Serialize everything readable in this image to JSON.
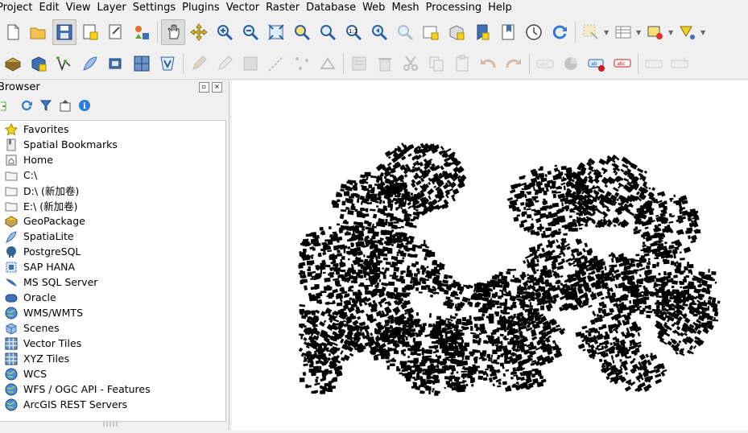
{
  "menubar": {
    "items": [
      "Project",
      "Edit",
      "View",
      "Layer",
      "Settings",
      "Plugins",
      "Vector",
      "Raster",
      "Database",
      "Web",
      "Mesh",
      "Processing",
      "Help"
    ]
  },
  "toolbar1": {
    "icons": [
      "new-project-icon",
      "open-project-icon",
      "save-project-icon",
      "new-print-layout-icon",
      "layout-manager-icon",
      "style-manager-icon",
      "pan-icon",
      "pan-to-selection-icon",
      "zoom-in-icon",
      "zoom-out-icon",
      "zoom-full-icon",
      "zoom-to-selection-icon",
      "zoom-to-layer-icon",
      "zoom-native-icon",
      "zoom-last-icon",
      "zoom-next-icon",
      "new-map-view-icon",
      "new-3d-map-view-icon",
      "new-bookmark-icon",
      "show-bookmarks-icon",
      "temporal-controller-icon",
      "refresh-icon",
      "select-features-icon",
      "attribute-table-icon",
      "deselect-icon",
      "add-shape-icon"
    ]
  },
  "toolbar2": {
    "icons": [
      "add-geopackage-layer-icon",
      "add-postgis-layer-icon",
      "add-vector-layer-icon",
      "add-spatialite-layer-icon",
      "add-sap-hana-layer-icon",
      "add-raster-layer-icon",
      "add-wms-layer-icon",
      "current-edits-icon",
      "toggle-editing-icon",
      "save-edits-icon",
      "digitize-icon",
      "vertex-tool-icon",
      "add-part-icon",
      "attribute-form-icon",
      "delete-selected-icon",
      "cut-features-icon",
      "copy-features-icon",
      "paste-features-icon",
      "undo-icon",
      "redo-icon",
      "label-icon",
      "diagram-icon",
      "highlight-label-icon",
      "pin-label-icon",
      "show-hide-labels-icon",
      "move-label-icon"
    ]
  },
  "browser": {
    "title": "Browser",
    "items": [
      {
        "label": "Favorites",
        "icon": "star-icon"
      },
      {
        "label": "Spatial Bookmarks",
        "icon": "bookmark-icon"
      },
      {
        "label": "Home",
        "icon": "home-folder-icon"
      },
      {
        "label": "C:\\",
        "icon": "folder-icon"
      },
      {
        "label": "D:\\ (新加卷)",
        "icon": "folder-icon"
      },
      {
        "label": "E:\\ (新加卷)",
        "icon": "folder-icon"
      },
      {
        "label": "GeoPackage",
        "icon": "geopackage-icon"
      },
      {
        "label": "SpatiaLite",
        "icon": "spatialite-icon"
      },
      {
        "label": "PostgreSQL",
        "icon": "postgresql-icon"
      },
      {
        "label": "SAP HANA",
        "icon": "sap-hana-icon"
      },
      {
        "label": "MS SQL Server",
        "icon": "mssql-icon"
      },
      {
        "label": "Oracle",
        "icon": "oracle-icon"
      },
      {
        "label": "WMS/WMTS",
        "icon": "globe-icon"
      },
      {
        "label": "Scenes",
        "icon": "cube-icon"
      },
      {
        "label": "Vector Tiles",
        "icon": "grid-icon"
      },
      {
        "label": "XYZ Tiles",
        "icon": "grid-icon"
      },
      {
        "label": "WCS",
        "icon": "globe-icon"
      },
      {
        "label": "WFS / OGC API - Features",
        "icon": "globe-icon"
      },
      {
        "label": "ArcGIS REST Servers",
        "icon": "globe-icon"
      }
    ]
  },
  "colors": {
    "accent_blue": "#1f6fc4",
    "folder": "#f5f5f5",
    "star": "#f7d21a",
    "features": "#000000"
  }
}
